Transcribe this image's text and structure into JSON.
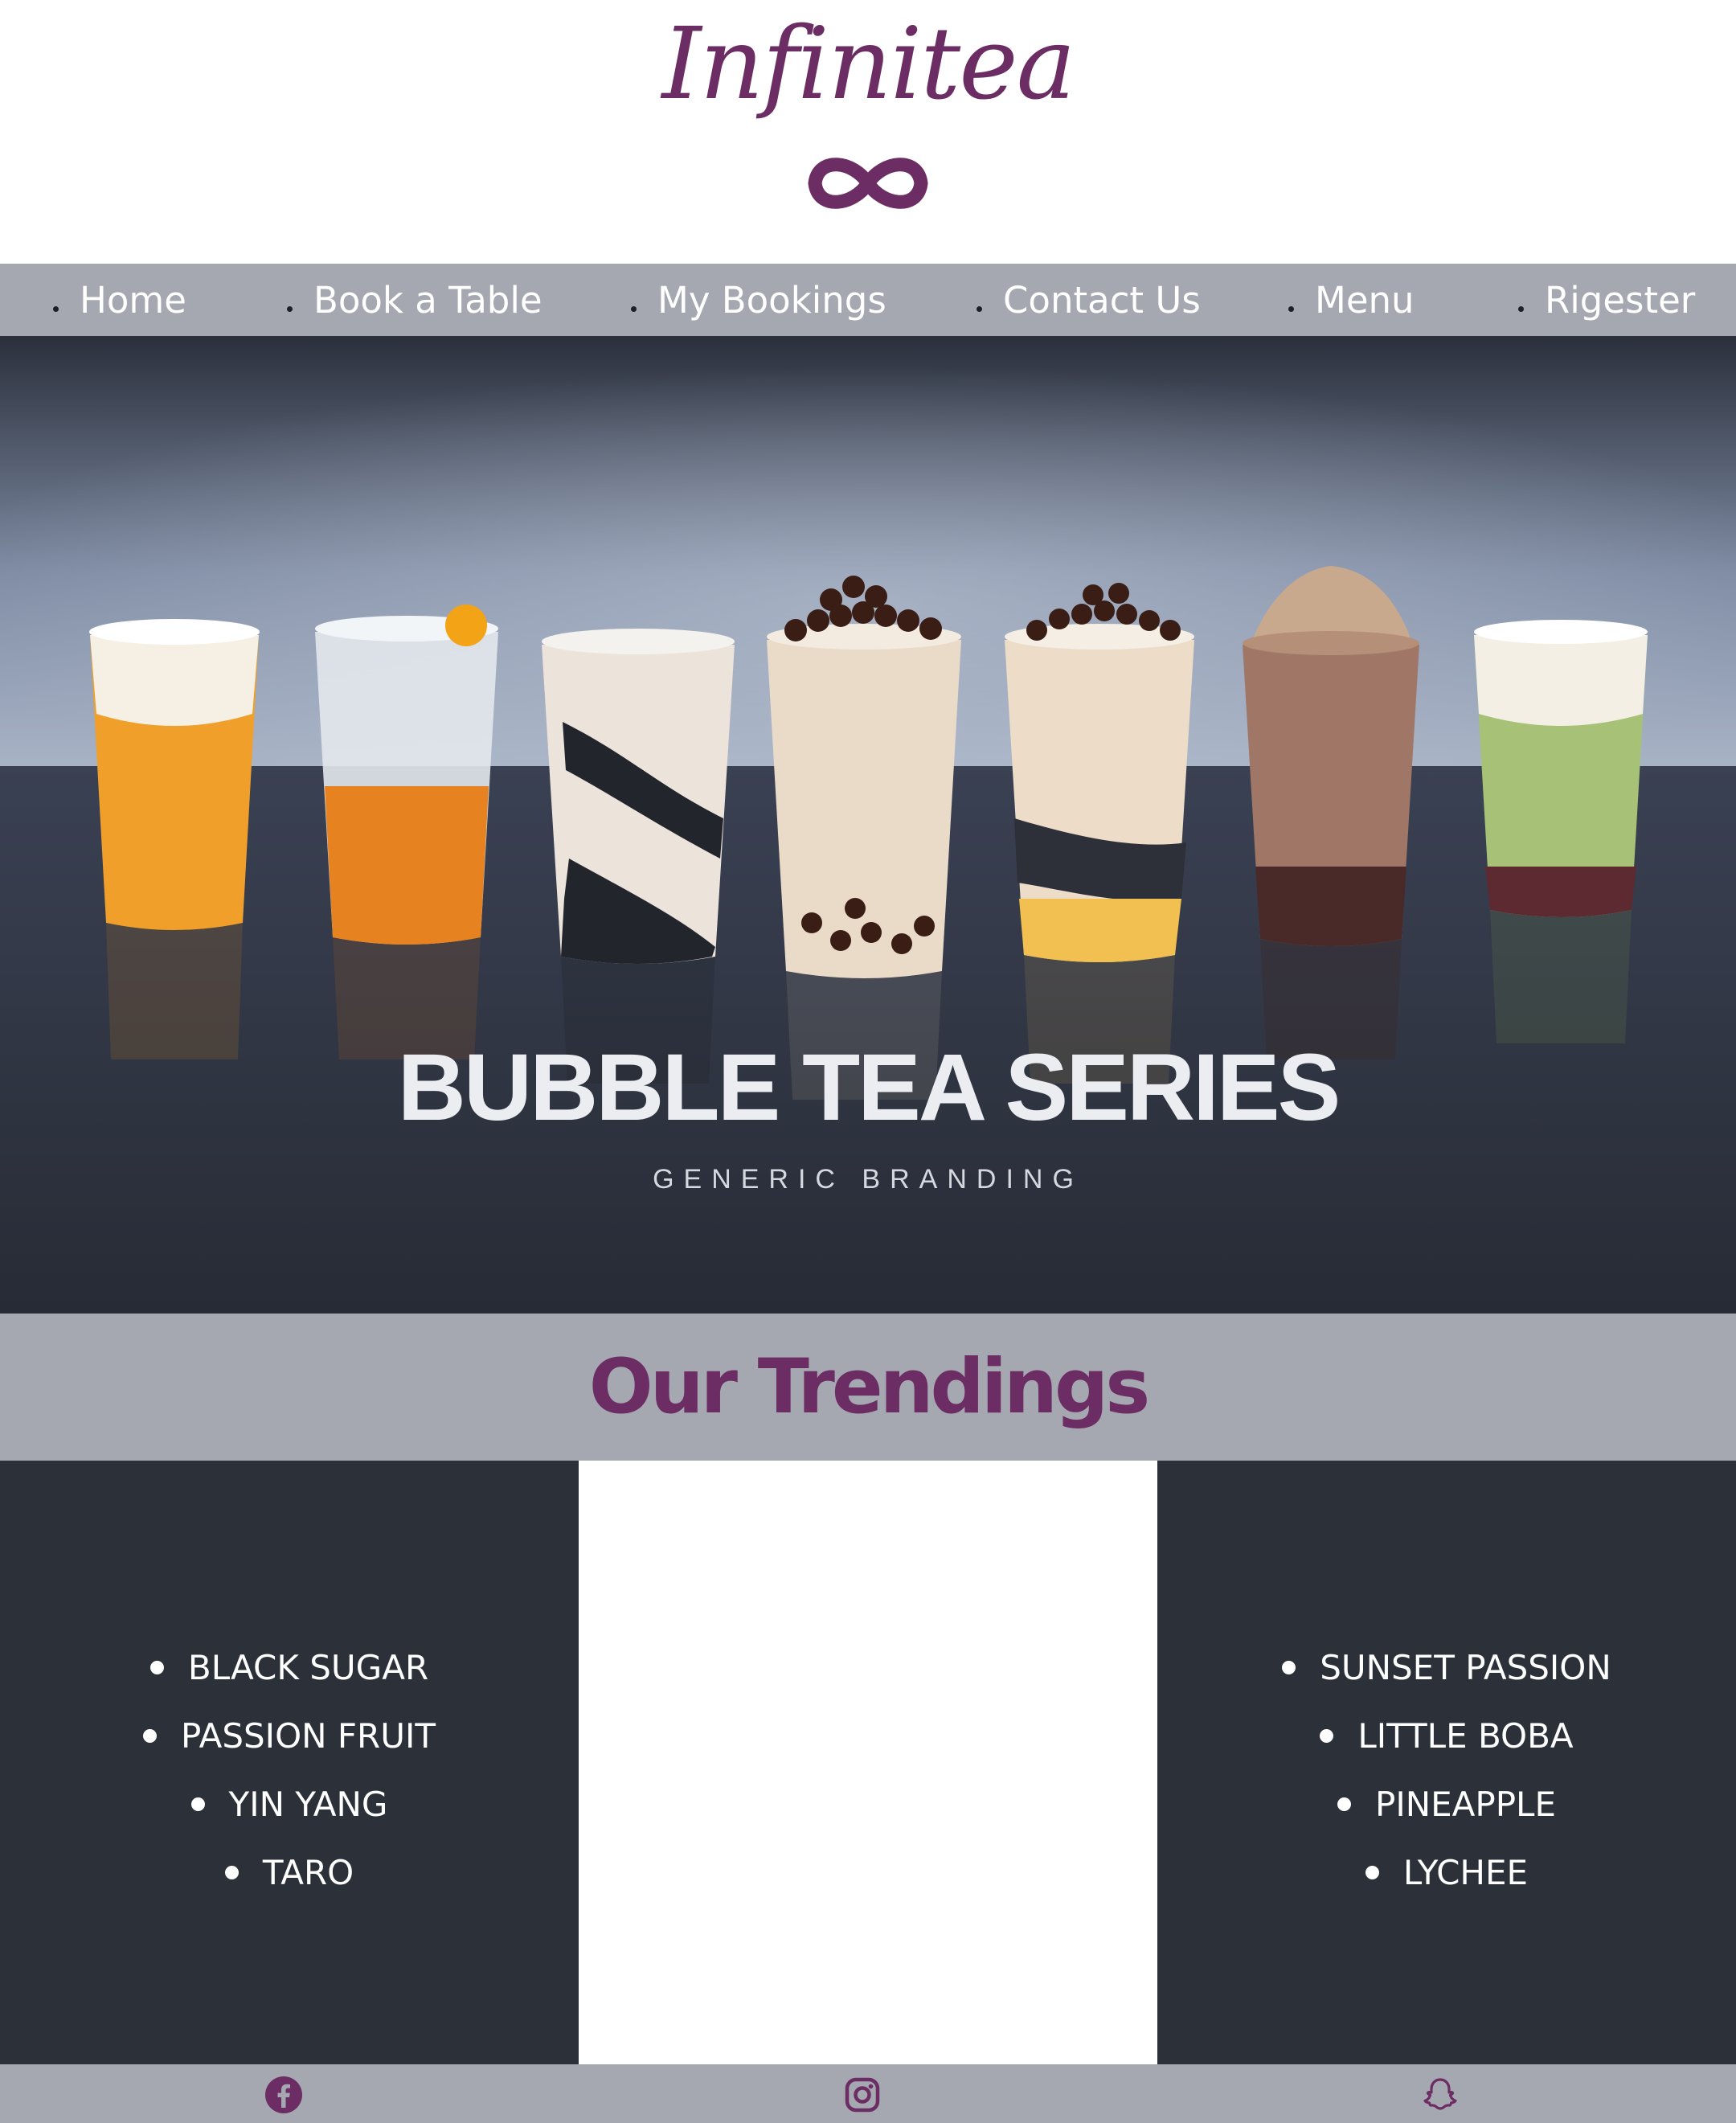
{
  "brand": {
    "name": "Infinitea",
    "color": "#6b2d63"
  },
  "nav": {
    "items": [
      {
        "label": "Home"
      },
      {
        "label": "Book a Table"
      },
      {
        "label": "My Bookings"
      },
      {
        "label": "Contact Us"
      },
      {
        "label": "Menu"
      },
      {
        "label": "Rigester"
      }
    ]
  },
  "hero": {
    "title": "BUBBLE TEA SERIES",
    "subtitle": "GENERIC BRANDING"
  },
  "trending": {
    "heading": "Our Trendings",
    "left_items": [
      "BLACK SUGAR",
      "PASSION FRUIT",
      "YIN YANG",
      "TARO"
    ],
    "right_items": [
      "SUNSET PASSION",
      "LITTLE BOBA",
      "PINEAPPLE",
      "LYCHEE"
    ]
  },
  "footer": {
    "icons": [
      "facebook-icon",
      "instagram-icon",
      "snapchat-icon"
    ]
  },
  "colors": {
    "accent": "#6b2d63",
    "band": "#a6a8b1",
    "dark_panel": "#2c3039"
  }
}
